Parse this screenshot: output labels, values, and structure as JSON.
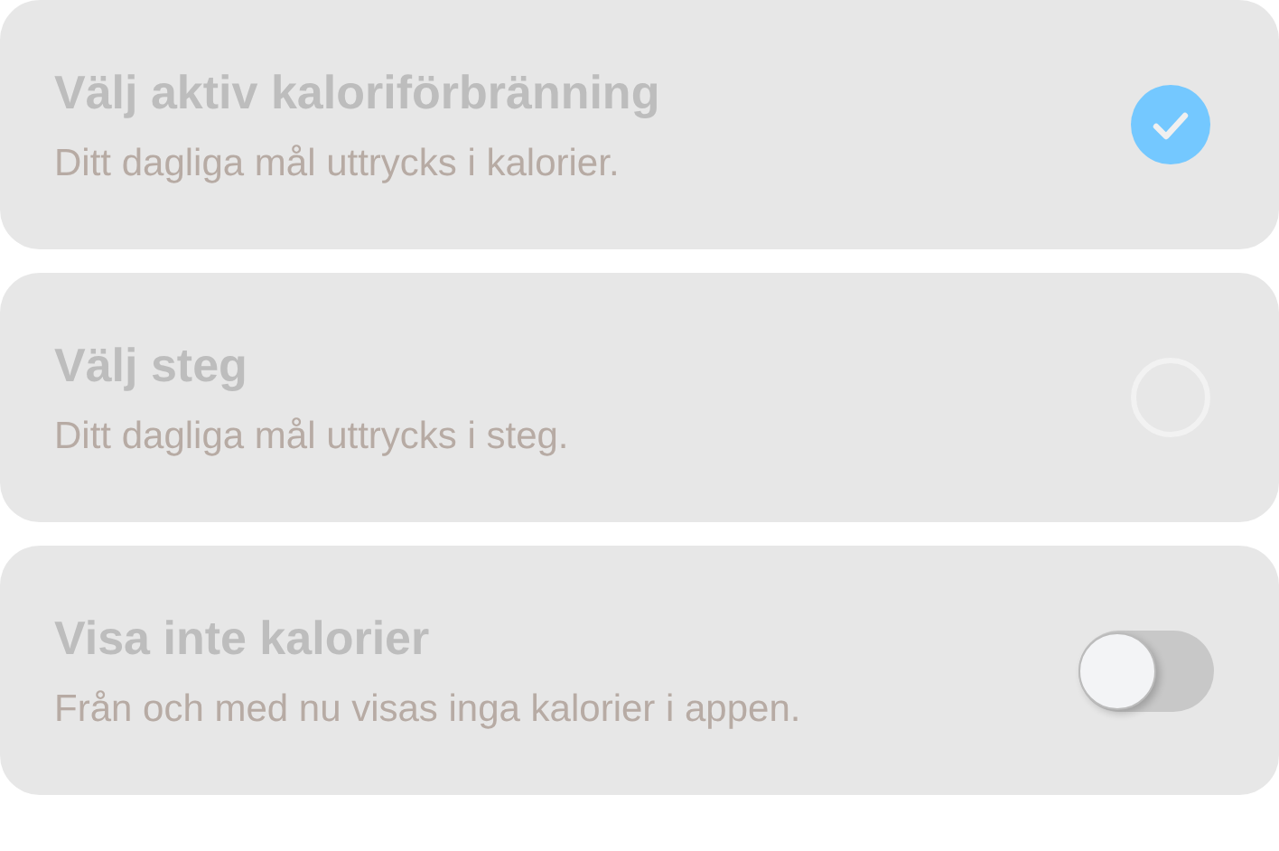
{
  "options": [
    {
      "kind": "radio",
      "title": "Välj aktiv kaloriförbränning",
      "description": "Ditt dagliga mål uttrycks i kalorier.",
      "selected": true
    },
    {
      "kind": "radio",
      "title": "Välj steg",
      "description": "Ditt dagliga mål uttrycks i steg.",
      "selected": false
    },
    {
      "kind": "toggle",
      "title": "Visa inte kalorier",
      "description": "Från och med nu visas inga kalorier i appen.",
      "on": false
    }
  ]
}
